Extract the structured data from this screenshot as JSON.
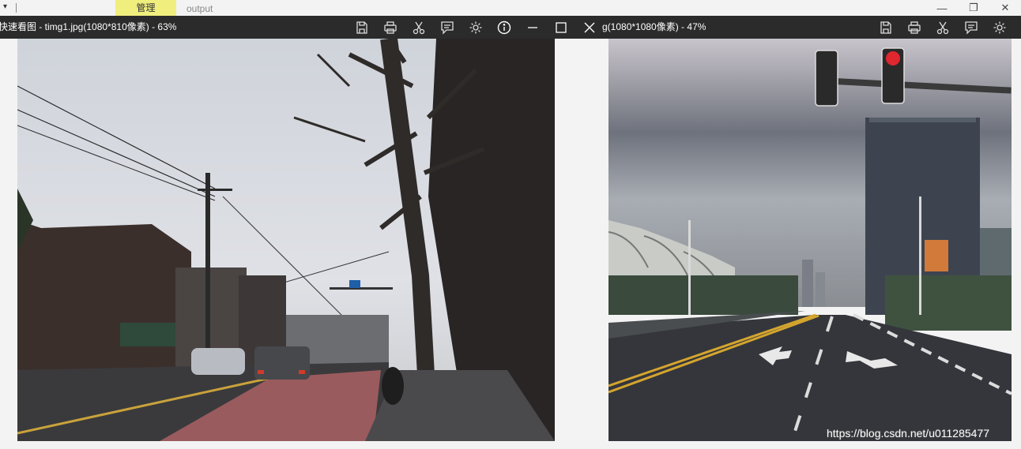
{
  "ribbon": {
    "manage_tab": "管理",
    "output_tab": "output"
  },
  "left_viewer": {
    "title": "快速看图 - timg1.jpg(1080*810像素) - 63%",
    "toolbar": [
      "save-icon",
      "print-icon",
      "cut-icon",
      "comment-icon",
      "settings-icon",
      "info-icon",
      "minimize-icon",
      "maximize-icon",
      "close-icon"
    ]
  },
  "right_viewer": {
    "title": "g(1080*1080像素) - 47%",
    "toolbar": [
      "save-icon",
      "print-icon",
      "cut-icon",
      "comment-icon",
      "settings-icon"
    ]
  },
  "watermark": "https://blog.csdn.net/u011285477",
  "colors": {
    "toolbar_bg": "#2b2b2b",
    "manage_tab": "#f0ef7e",
    "background": "#f3f3f3"
  }
}
